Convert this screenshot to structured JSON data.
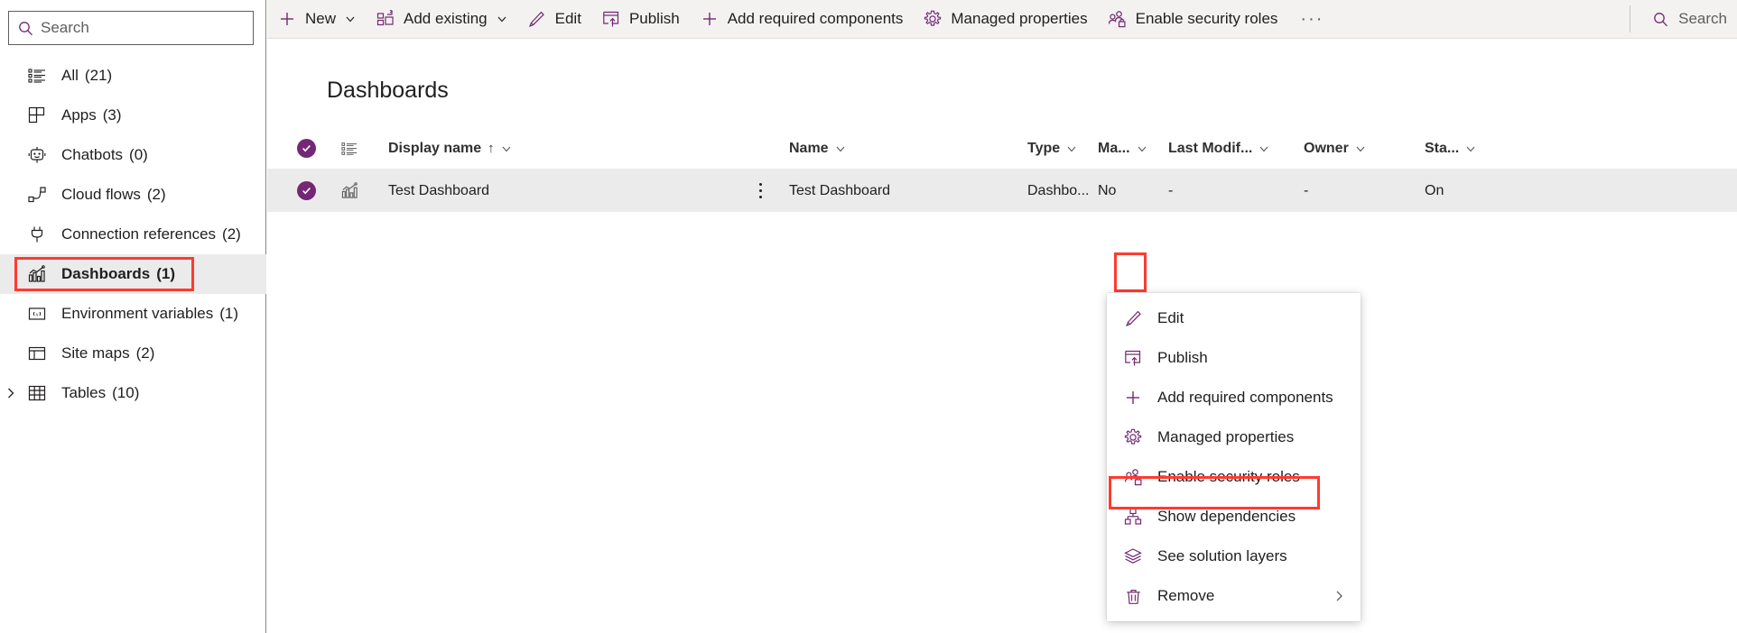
{
  "accent": "#742774",
  "highlight_color": "#ff3b30",
  "sidebar": {
    "search": {
      "placeholder": "Search",
      "icon": "search-icon"
    },
    "items": [
      {
        "label": "All",
        "count": "(21)",
        "icon": "list-icon",
        "selected": false,
        "expand": false
      },
      {
        "label": "Apps",
        "count": "(3)",
        "icon": "apps-grid-icon",
        "selected": false,
        "expand": false
      },
      {
        "label": "Chatbots",
        "count": "(0)",
        "icon": "chatbot-icon",
        "selected": false,
        "expand": false
      },
      {
        "label": "Cloud flows",
        "count": "(2)",
        "icon": "cloud-flow-icon",
        "selected": false,
        "expand": false
      },
      {
        "label": "Connection references",
        "count": "(2)",
        "icon": "plug-icon",
        "selected": false,
        "expand": false
      },
      {
        "label": "Dashboards",
        "count": "(1)",
        "icon": "dashboard-chart-icon",
        "selected": true,
        "expand": false
      },
      {
        "label": "Environment variables",
        "count": "(1)",
        "icon": "variable-icon",
        "selected": false,
        "expand": false
      },
      {
        "label": "Site maps",
        "count": "(2)",
        "icon": "sitemap-layout-icon",
        "selected": false,
        "expand": false
      },
      {
        "label": "Tables",
        "count": "(10)",
        "icon": "table-grid-icon",
        "selected": false,
        "expand": true
      }
    ]
  },
  "commandbar": {
    "items": [
      {
        "label": "New",
        "icon": "plus-icon",
        "caret": true
      },
      {
        "label": "Add existing",
        "icon": "add-existing-icon",
        "caret": true
      },
      {
        "label": "Edit",
        "icon": "pencil-icon",
        "caret": false
      },
      {
        "label": "Publish",
        "icon": "publish-icon",
        "caret": false
      },
      {
        "label": "Add required components",
        "icon": "plus-icon",
        "caret": false
      },
      {
        "label": "Managed properties",
        "icon": "gear-icon",
        "caret": false
      },
      {
        "label": "Enable security roles",
        "icon": "security-roles-icon",
        "caret": false
      }
    ],
    "overflow_label": "···",
    "search": {
      "placeholder": "Search",
      "icon": "search-icon"
    }
  },
  "main": {
    "page_title": "Dashboards",
    "columns": [
      {
        "key": "display_name",
        "label": "Display name",
        "sort": "↑",
        "caret": true
      },
      {
        "key": "name",
        "label": "Name",
        "sort": "",
        "caret": true
      },
      {
        "key": "type",
        "label": "Type",
        "sort": "",
        "caret": true
      },
      {
        "key": "managed",
        "label": "Ma...",
        "sort": "",
        "caret": true
      },
      {
        "key": "last_modified",
        "label": "Last Modif...",
        "sort": "",
        "caret": true
      },
      {
        "key": "owner",
        "label": "Owner",
        "sort": "",
        "caret": true
      },
      {
        "key": "status",
        "label": "Sta...",
        "sort": "",
        "caret": true
      }
    ],
    "rows": [
      {
        "selected": true,
        "row_icon": "dashboard-chart-icon",
        "display_name": "Test Dashboard",
        "name": "Test Dashboard",
        "type": "Dashbo...",
        "managed": "No",
        "last_modified": "-",
        "owner": "-",
        "status": "On"
      }
    ]
  },
  "context_menu": {
    "items": [
      {
        "label": "Edit",
        "icon": "pencil-icon",
        "submenu": false,
        "highlighted": false
      },
      {
        "label": "Publish",
        "icon": "publish-icon",
        "submenu": false,
        "highlighted": false
      },
      {
        "label": "Add required components",
        "icon": "plus-icon",
        "submenu": false,
        "highlighted": false
      },
      {
        "label": "Managed properties",
        "icon": "gear-icon",
        "submenu": false,
        "highlighted": false
      },
      {
        "label": "Enable security roles",
        "icon": "security-roles-icon",
        "submenu": false,
        "highlighted": true
      },
      {
        "label": "Show dependencies",
        "icon": "dependencies-icon",
        "submenu": false,
        "highlighted": false
      },
      {
        "label": "See solution layers",
        "icon": "layers-icon",
        "submenu": false,
        "highlighted": false
      },
      {
        "label": "Remove",
        "icon": "trash-icon",
        "submenu": true,
        "highlighted": false
      }
    ]
  }
}
